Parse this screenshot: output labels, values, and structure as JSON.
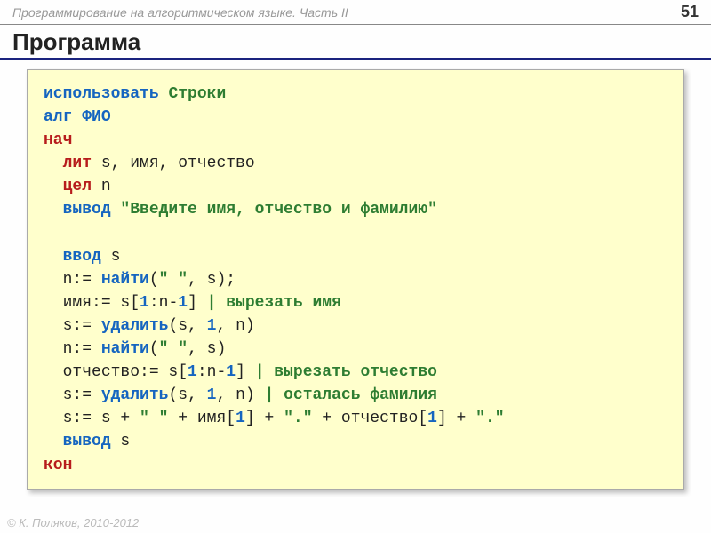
{
  "header": {
    "breadcrumb": "Программирование на алгоритмическом языке. Часть II",
    "page_number": "51"
  },
  "title": "Программа",
  "code": {
    "use_kw": "использовать",
    "lib_name": "Строки",
    "alg_kw": "алг",
    "alg_name": "ФИО",
    "begin_kw": "нач",
    "lit_kw": "лит",
    "lit_vars": " s, имя, отчество",
    "int_kw": "цел",
    "int_var": " n",
    "out_kw": "вывод",
    "out_str": " \"Введите имя, отчество и фамилию\"",
    "in_kw": "ввод",
    "in_var": " s",
    "l_n1a": "n:= ",
    "find1": "найти",
    "l_n1b": "(",
    "space_str1": "\" \"",
    "l_n1c": ", s);",
    "l_name_a": "имя:= s[",
    "one1": "1",
    "l_name_b": ":n-",
    "one2": "1",
    "l_name_c": "]  ",
    "cm_name": "| вырезать имя",
    "l_del1a": "s:= ",
    "del1": "удалить",
    "l_del1b": "(s, ",
    "one3": "1",
    "l_del1c": ", n)",
    "l_n2a": "n:= ",
    "find2": "найти",
    "l_n2b": "(",
    "space_str2": "\" \"",
    "l_n2c": ", s)",
    "l_pat_a": "отчество:= s[",
    "one4": "1",
    "l_pat_b": ":n-",
    "one5": "1",
    "l_pat_c": "]   ",
    "cm_pat": "| вырезать отчество",
    "l_del2a": "s:= ",
    "del2": "удалить",
    "l_del2b": "(s, ",
    "one6": "1",
    "l_del2c": ", n)  ",
    "cm_del2": "| осталась фамилия",
    "l_cat_a": "s:= s + ",
    "sp1": "\" \"",
    "l_cat_b": " + имя[",
    "one7": "1",
    "l_cat_c": "] + ",
    "dot1": "\".\"",
    "l_cat_d": " + отчество[",
    "one8": "1",
    "l_cat_e": "] + ",
    "dot2": "\".\"",
    "out2_kw": "вывод",
    "out2_var": " s",
    "end_kw": "кон"
  },
  "footer": "© К. Поляков, 2010-2012"
}
